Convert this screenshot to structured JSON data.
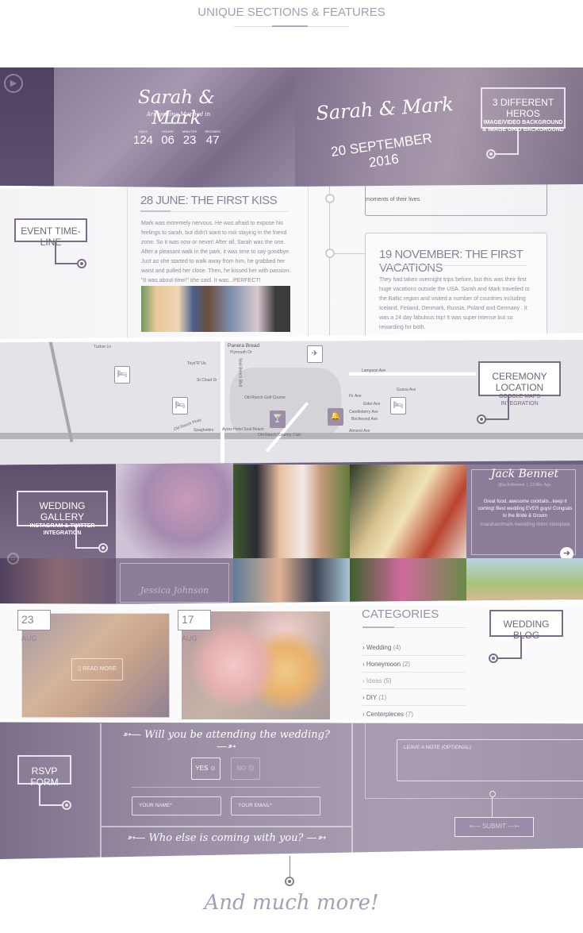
{
  "header": {
    "title": "UNIQUE SECTIONS & FEATURES"
  },
  "hero": {
    "couple": "Sarah & Mark",
    "subtitle": "Are getting Married in",
    "countdown": [
      {
        "label": "DAYS",
        "value": "124"
      },
      {
        "label": "HOURS",
        "value": "06"
      },
      {
        "label": "MINUTES",
        "value": "23"
      },
      {
        "label": "SECONDS",
        "value": "47"
      }
    ],
    "date": "20 SEPTEMBER 2016",
    "callout_title": "3 DIFFERENT HEROS",
    "callout_sub1": "IMAGE/VIDEO BACKGROUND",
    "callout_sub2": "& IMAGE GRID BACKGROUND",
    "play_icon": "play-circle-icon"
  },
  "timeline": {
    "callout": "EVENT TIME-LINE",
    "prev_text": "moments of their lives.",
    "events": [
      {
        "title": "28 JUNE: THE FIRST KISS",
        "text": "Mark was extremely nervous. He was afraid to expose his feelings to sarah, but didn't want to risk staying in the friend zone. So it was now or never! After all, Sarah was the one. After a pleasant walk in the park, it was time to say goodbye. Just as she started to walk away from him, he grabbed her waist and pulled her close. Then, he kissed her with passion. \"It was about time!\" she said. It was...PERFECT!"
      },
      {
        "title": "19 NOVEMBER: THE FIRST VACATIONS",
        "text": "They had taken overnight trips before, but this was their first huge vacations outside the USA. Sarah and Mark travelled to the Baltic region and visited a number of countries including Iceland, Finland, Denmark, Russia, Poland and Germany . It was a 24 day fabulous trip! It was super intense but so rewarding for both."
      }
    ]
  },
  "map": {
    "callout_title": "CEREMONY LOCATION",
    "callout_sub": "GOOGLE MAPS INTEGRATION",
    "labels": [
      "Tucker Ln",
      "Panera Bread",
      "Plymouth Dr",
      "Toys\"R\"Us",
      "Seal Beach Blvd",
      "St Cloud Dr",
      "Lampson Ave",
      "Old Ranch Golf Course",
      "Old Ranch Pkwy",
      "Spaghettini",
      "Ayres Hotel Seal Beach",
      "Old Ranch Country Club",
      "Elder Ave",
      "Candleberry Ave",
      "Birchwood Ave",
      "Almond Ave",
      "Fir Ave",
      "Guava Ave"
    ],
    "pins": [
      "hotel-icon",
      "hotel-icon",
      "airplane-icon",
      "cocktail-icon",
      "bell-icon",
      "hotel-icon"
    ]
  },
  "gallery": {
    "callout_title": "WEDDING GALLERY",
    "callout_sub": "INSTAGRAM & TWITTER INTEGRATION",
    "caption": "Jessica Johnson",
    "tweet": {
      "name": "Jack Bennet",
      "handle": "@jackstbennet",
      "time": "12 Min. Ago",
      "text": "Great food, awesome cocktails...keep it coming! Best wedding EVER guys! Congrats to the Bride & Groom",
      "tags": "#sarahandmark #wedding #html #template"
    }
  },
  "blog": {
    "callout": "WEDDING BLOG",
    "posts": [
      {
        "day": "23",
        "month": "AUG",
        "action": "READ MORE"
      },
      {
        "day": "17",
        "month": "AUG"
      }
    ],
    "categories_title": "CATEGORIES",
    "categories": [
      {
        "name": "Wedding",
        "count": "(4)"
      },
      {
        "name": "Honeymoon",
        "count": "(2)"
      },
      {
        "name": "Ideas",
        "count": "(5)"
      },
      {
        "name": "DIY",
        "count": "(1)"
      },
      {
        "name": "Centerpieces",
        "count": "(7)"
      }
    ]
  },
  "rsvp": {
    "callout": "RSVP FORM",
    "question": "Will you be attending the wedding?",
    "yes": "YES",
    "no": "NO",
    "name_placeholder": "YOUR NAME*",
    "email_placeholder": "YOUR EMAIL*",
    "guests": "Who else is coming with you?",
    "note_placeholder": "LEAVE A NOTE (OPTIONAL)",
    "submit": "SUBMIT"
  },
  "footer": {
    "text": "And much more!"
  },
  "colors": {
    "accent": "#7b6d88",
    "hero": "#6e6079",
    "rsvp": "#9d91a8"
  }
}
